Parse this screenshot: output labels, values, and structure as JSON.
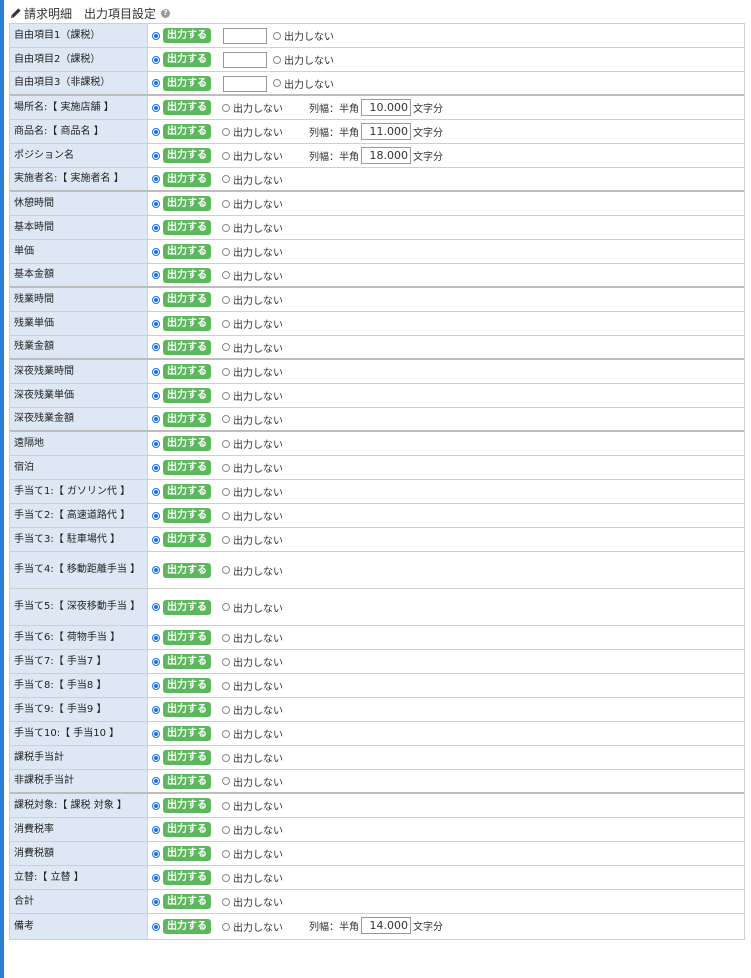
{
  "header": {
    "title": "請求明細　出力項目設定",
    "help_glyph": "?"
  },
  "common": {
    "on_label": "出力する",
    "off_label": "出力しない",
    "width_prefix": "列幅：半角",
    "width_suffix": "文字分"
  },
  "rows": [
    {
      "label": "自由項目1（課税）",
      "type": "free"
    },
    {
      "label": "自由項目2（課税）",
      "type": "free"
    },
    {
      "label": "自由項目3（非課税）",
      "type": "free",
      "sep": true
    },
    {
      "label": "場所名:【 実施店舗 】",
      "type": "width",
      "width": "10.000"
    },
    {
      "label": "商品名:【 商品名 】",
      "type": "width",
      "width": "11.000"
    },
    {
      "label": "ポジション名",
      "type": "width",
      "width": "18.000"
    },
    {
      "label": "実施者名:【 実施者名 】",
      "type": "plain",
      "sep": true
    },
    {
      "label": "休憩時間",
      "type": "plain"
    },
    {
      "label": "基本時間",
      "type": "plain"
    },
    {
      "label": "単価",
      "type": "plain"
    },
    {
      "label": "基本金額",
      "type": "plain",
      "sep": true
    },
    {
      "label": "残業時間",
      "type": "plain"
    },
    {
      "label": "残業単価",
      "type": "plain"
    },
    {
      "label": "残業金額",
      "type": "plain",
      "sep": true
    },
    {
      "label": "深夜残業時間",
      "type": "plain"
    },
    {
      "label": "深夜残業単価",
      "type": "plain"
    },
    {
      "label": "深夜残業金額",
      "type": "plain",
      "sep": true
    },
    {
      "label": "遠隔地",
      "type": "plain"
    },
    {
      "label": "宿泊",
      "type": "plain"
    },
    {
      "label": "手当て1:【 ガソリン代 】",
      "type": "plain"
    },
    {
      "label": "手当て2:【 高速道路代 】",
      "type": "plain"
    },
    {
      "label": "手当て3:【 駐車場代 】",
      "type": "plain"
    },
    {
      "label": "手当て4:【 移動距離手当 】",
      "type": "plain",
      "tall": true
    },
    {
      "label": "手当て5:【 深夜移動手当 】",
      "type": "plain",
      "tall": true
    },
    {
      "label": "手当て6:【 荷物手当 】",
      "type": "plain"
    },
    {
      "label": "手当て7:【 手当7 】",
      "type": "plain"
    },
    {
      "label": "手当て8:【 手当8 】",
      "type": "plain"
    },
    {
      "label": "手当て9:【 手当9 】",
      "type": "plain"
    },
    {
      "label": "手当て10:【 手当10 】",
      "type": "plain"
    },
    {
      "label": "課税手当計",
      "type": "plain"
    },
    {
      "label": "非課税手当計",
      "type": "plain",
      "sep": true
    },
    {
      "label": "課税対象:【 課税 対象 】",
      "type": "plain"
    },
    {
      "label": "消費税率",
      "type": "plain"
    },
    {
      "label": "消費税額",
      "type": "plain"
    },
    {
      "label": "立替:【 立替 】",
      "type": "plain"
    },
    {
      "label": "合計",
      "type": "plain"
    },
    {
      "label": "備考",
      "type": "width",
      "width": "14.000",
      "tall_small": true
    }
  ],
  "colors": {
    "accent_bar": "#2d7fd1",
    "label_bg": "#dde8f4",
    "badge_bg": "#5cb85c",
    "radio_on": "#1a73e8"
  }
}
